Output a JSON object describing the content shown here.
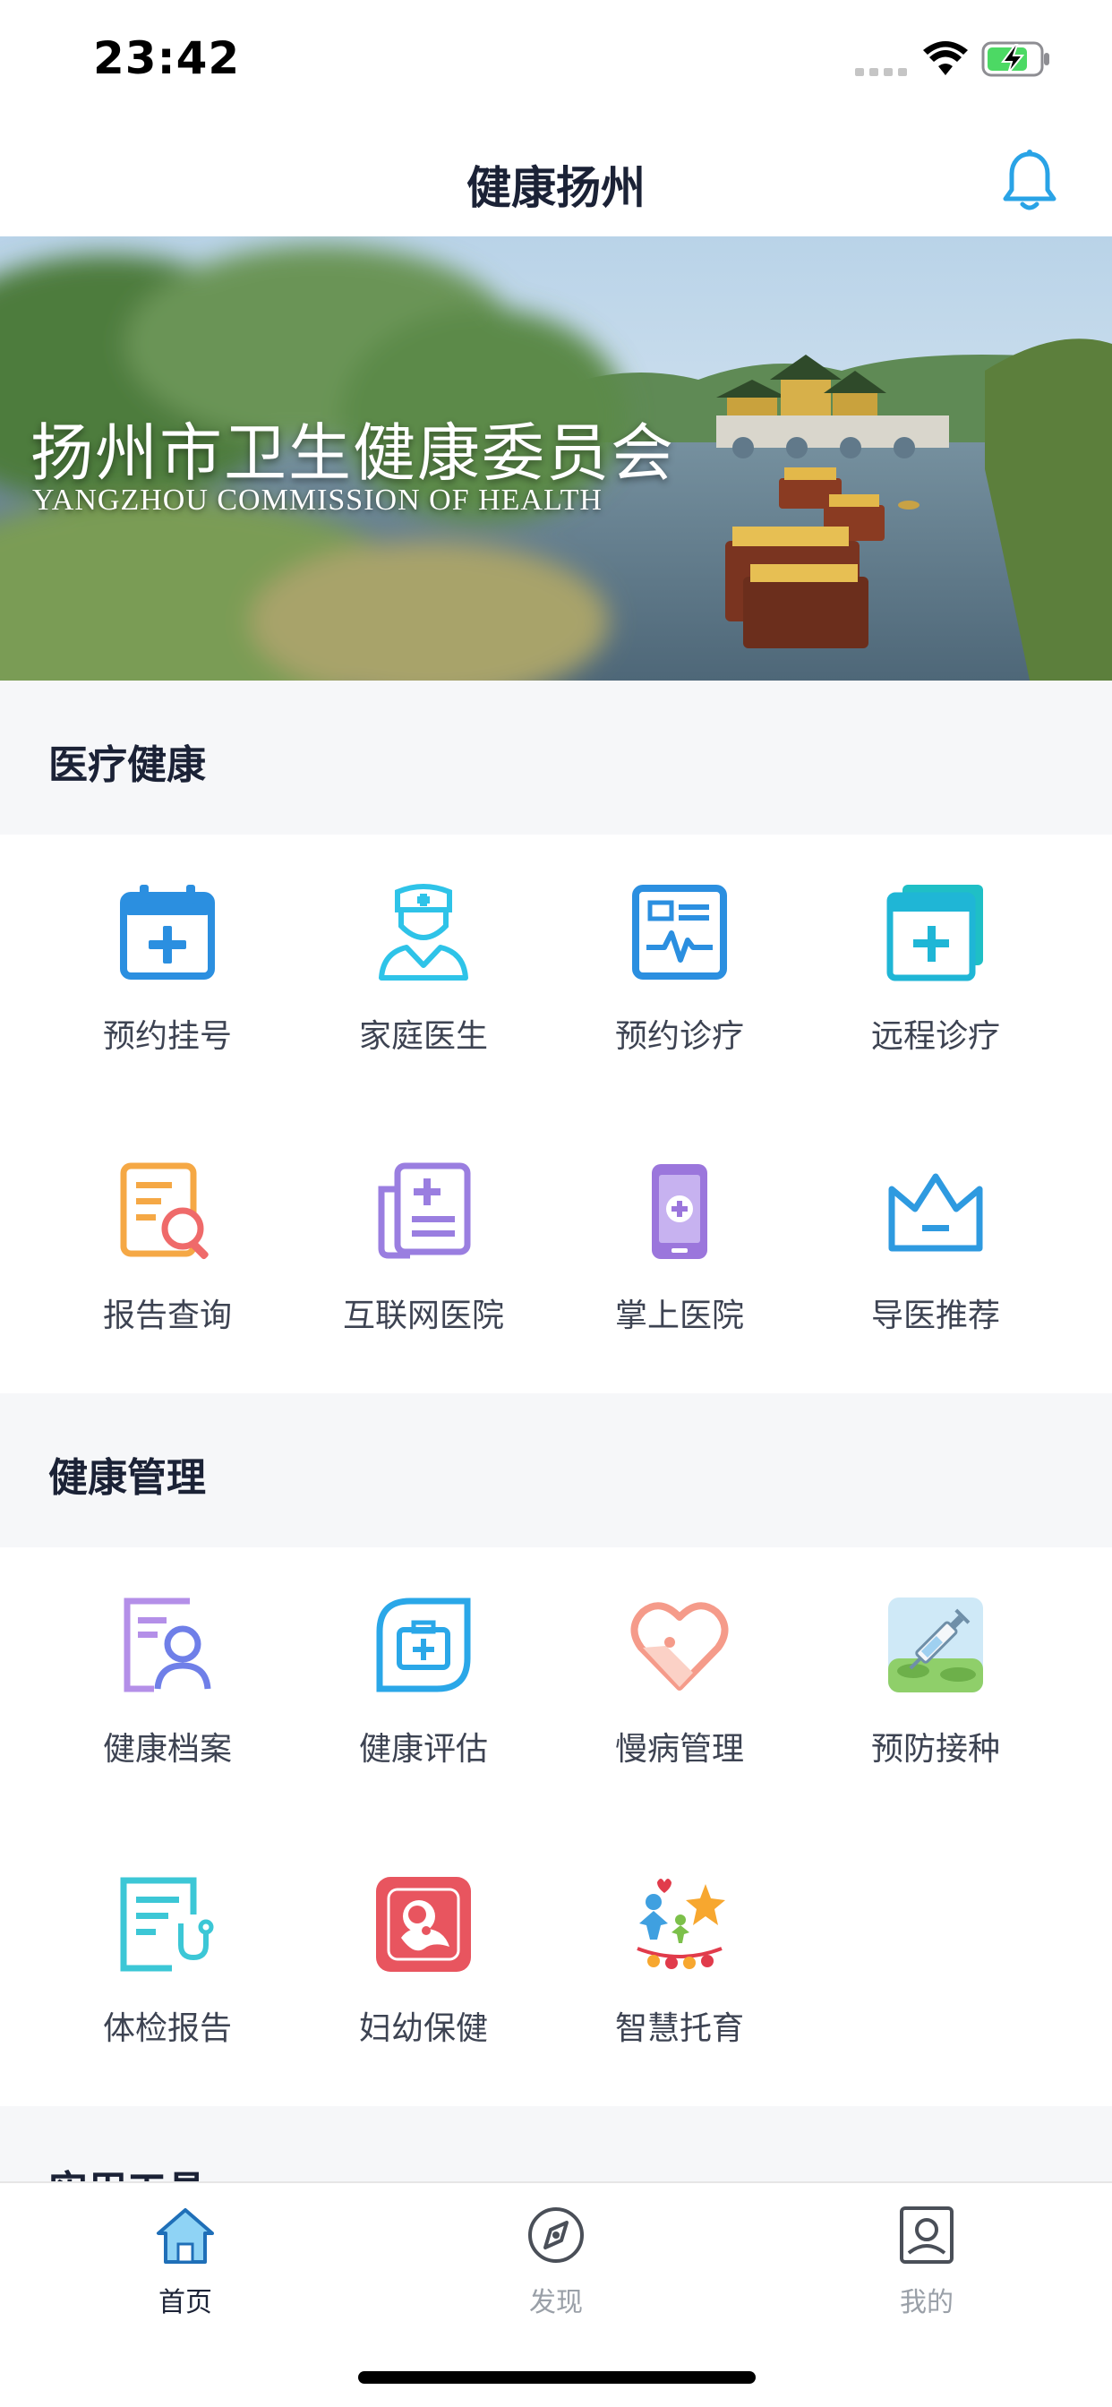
{
  "status_bar": {
    "time": "23:42"
  },
  "header": {
    "title": "健康扬州"
  },
  "banner": {
    "title": "扬州市卫生健康委员会",
    "subtitle": "YANGZHOU COMMISSION OF HEALTH"
  },
  "sections": {
    "medical": {
      "title": "医疗健康",
      "items": [
        {
          "label": "预约挂号",
          "icon": "calendar-plus-icon"
        },
        {
          "label": "家庭医生",
          "icon": "nurse-icon"
        },
        {
          "label": "预约诊疗",
          "icon": "ecg-card-icon"
        },
        {
          "label": "远程诊疗",
          "icon": "remote-window-icon"
        },
        {
          "label": "报告查询",
          "icon": "report-search-icon"
        },
        {
          "label": "互联网医院",
          "icon": "internet-hospital-icon"
        },
        {
          "label": "掌上医院",
          "icon": "mobile-hospital-icon"
        },
        {
          "label": "导医推荐",
          "icon": "crown-icon"
        }
      ]
    },
    "health_mgmt": {
      "title": "健康管理",
      "items": [
        {
          "label": "健康档案",
          "icon": "profile-icon"
        },
        {
          "label": "健康评估",
          "icon": "medkit-icon"
        },
        {
          "label": "慢病管理",
          "icon": "heart-icon"
        },
        {
          "label": "预防接种",
          "icon": "syringe-icon"
        },
        {
          "label": "体检报告",
          "icon": "checkup-report-icon"
        },
        {
          "label": "妇幼保健",
          "icon": "maternal-icon"
        },
        {
          "label": "智慧托育",
          "icon": "childcare-icon"
        }
      ]
    },
    "tools": {
      "title": "实用工具"
    }
  },
  "tabs": [
    {
      "label": "首页",
      "icon": "home-icon",
      "active": true
    },
    {
      "label": "发现",
      "icon": "compass-icon",
      "active": false
    },
    {
      "label": "我的",
      "icon": "profile-frame-icon",
      "active": false
    }
  ],
  "colors": {
    "accent": "#2f8fd8",
    "title": "#1b2236",
    "section_bg": "#f6f7f9",
    "tab_inactive": "#9aa0a8"
  }
}
